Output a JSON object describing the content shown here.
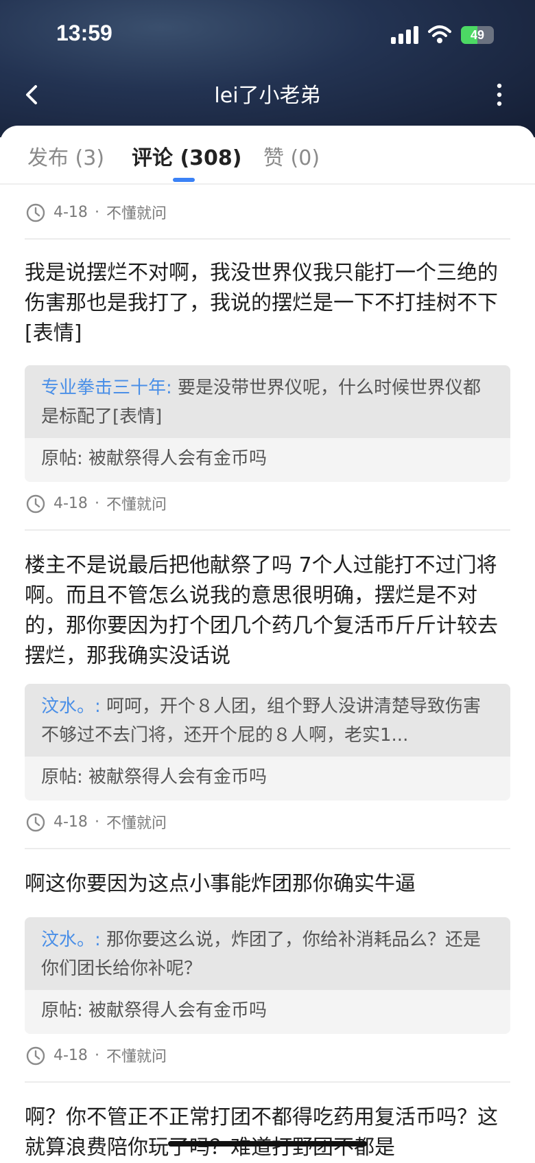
{
  "status": {
    "time": "13:59",
    "battery": "49",
    "battery_level": 0.49
  },
  "header": {
    "title": "lei了小老弟"
  },
  "tabs": [
    {
      "label": "发布 (3)"
    },
    {
      "label": "评论 (308)"
    },
    {
      "label": "赞 (0)"
    }
  ],
  "feed": {
    "first_meta": {
      "date": "4-18",
      "sep": "·",
      "category": "不懂就问"
    },
    "items": [
      {
        "text": "我是说摆烂不对啊，我没世界仪我只能打一个三绝的伤害那也是我打了，我说的摆烂是一下不打挂树不下[表情]",
        "reply_author": "专业拳击三十年:",
        "reply_text": "要是没带世界仪呢，什么时候世界仪都是标配了[表情]",
        "post_label": "原帖:",
        "post_title": "被献祭得人会有金币吗",
        "date": "4-18",
        "sep": "·",
        "category": "不懂就问"
      },
      {
        "text": "楼主不是说最后把他献祭了吗 7个人过能打不过门将啊。而且不管怎么说我的意思很明确，摆烂是不对的，那你要因为打个团几个药几个复活币斤斤计较去摆烂，那我确实没话说",
        "reply_author": "汶水。:",
        "reply_text": "呵呵，开个８人团，组个野人没讲清楚导致伤害不够过不去门将，还开个屁的８人啊，老实1...",
        "post_label": "原帖:",
        "post_title": "被献祭得人会有金币吗",
        "date": "4-18",
        "sep": "·",
        "category": "不懂就问"
      },
      {
        "text": "啊这你要因为这点小事能炸团那你确实牛逼",
        "reply_author": "汶水。:",
        "reply_text": "那你要这么说，炸团了，你给补消耗品么？还是你们团长给你补呢？",
        "post_label": "原帖:",
        "post_title": "被献祭得人会有金币吗",
        "date": "4-18",
        "sep": "·",
        "category": "不懂就问"
      },
      {
        "text": "啊？你不管正不正常打团不都得吃药用复活币吗？这就算浪费陪你玩了吗？难道打野团不都是"
      }
    ]
  }
}
